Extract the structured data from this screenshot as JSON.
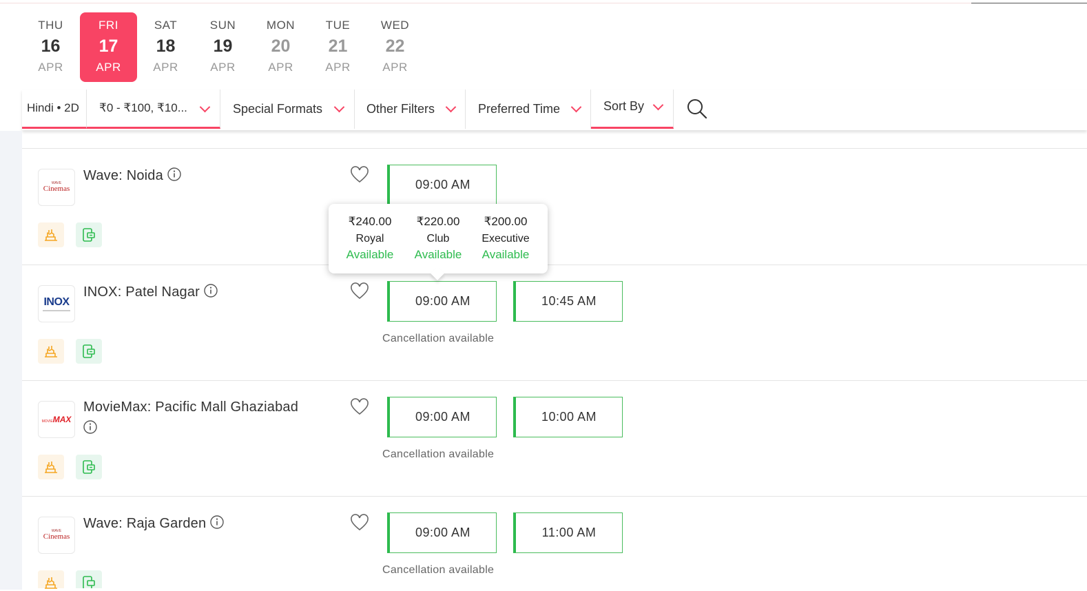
{
  "dates": [
    {
      "dow": "THU",
      "num": "16",
      "mon": "APR",
      "state": "normal"
    },
    {
      "dow": "FRI",
      "num": "17",
      "mon": "APR",
      "state": "selected"
    },
    {
      "dow": "SAT",
      "num": "18",
      "mon": "APR",
      "state": "normal"
    },
    {
      "dow": "SUN",
      "num": "19",
      "mon": "APR",
      "state": "normal"
    },
    {
      "dow": "MON",
      "num": "20",
      "mon": "APR",
      "state": "dim"
    },
    {
      "dow": "TUE",
      "num": "21",
      "mon": "APR",
      "state": "dim"
    },
    {
      "dow": "WED",
      "num": "22",
      "mon": "APR",
      "state": "dim"
    }
  ],
  "filters": {
    "language": "Hindi • 2D",
    "price": "₹0 - ₹100, ₹10...",
    "special_formats": "Special Formats",
    "other_filters": "Other Filters",
    "preferred_time": "Preferred Time",
    "sort_by": "Sort By"
  },
  "venues": [
    {
      "name": "Wave: Noida",
      "logo": "Cinemas",
      "logo_small": "WAVE",
      "showtimes": [
        "09:00 AM"
      ],
      "cancellation": ""
    },
    {
      "name": "INOX: Patel Nagar",
      "logo": "INOX",
      "logo_small": "",
      "showtimes": [
        "09:00 AM",
        "10:45 AM"
      ],
      "cancellation": "Cancellation available"
    },
    {
      "name": "MovieMax: Pacific Mall Ghaziabad",
      "logo": "MAX",
      "logo_small": "MOVIE",
      "showtimes": [
        "09:00 AM",
        "10:00 AM"
      ],
      "cancellation": "Cancellation available"
    },
    {
      "name": "Wave: Raja Garden",
      "logo": "Cinemas",
      "logo_small": "WAVE",
      "showtimes": [
        "09:00 AM",
        "11:00 AM"
      ],
      "cancellation": "Cancellation available"
    }
  ],
  "tooltip": [
    {
      "price": "₹240.00",
      "class": "Royal",
      "status": "Available"
    },
    {
      "price": "₹220.00",
      "class": "Club",
      "status": "Available"
    },
    {
      "price": "₹200.00",
      "class": "Executive",
      "status": "Available"
    }
  ],
  "colors": {
    "accent": "#f84464",
    "available": "#2dbb4e"
  }
}
